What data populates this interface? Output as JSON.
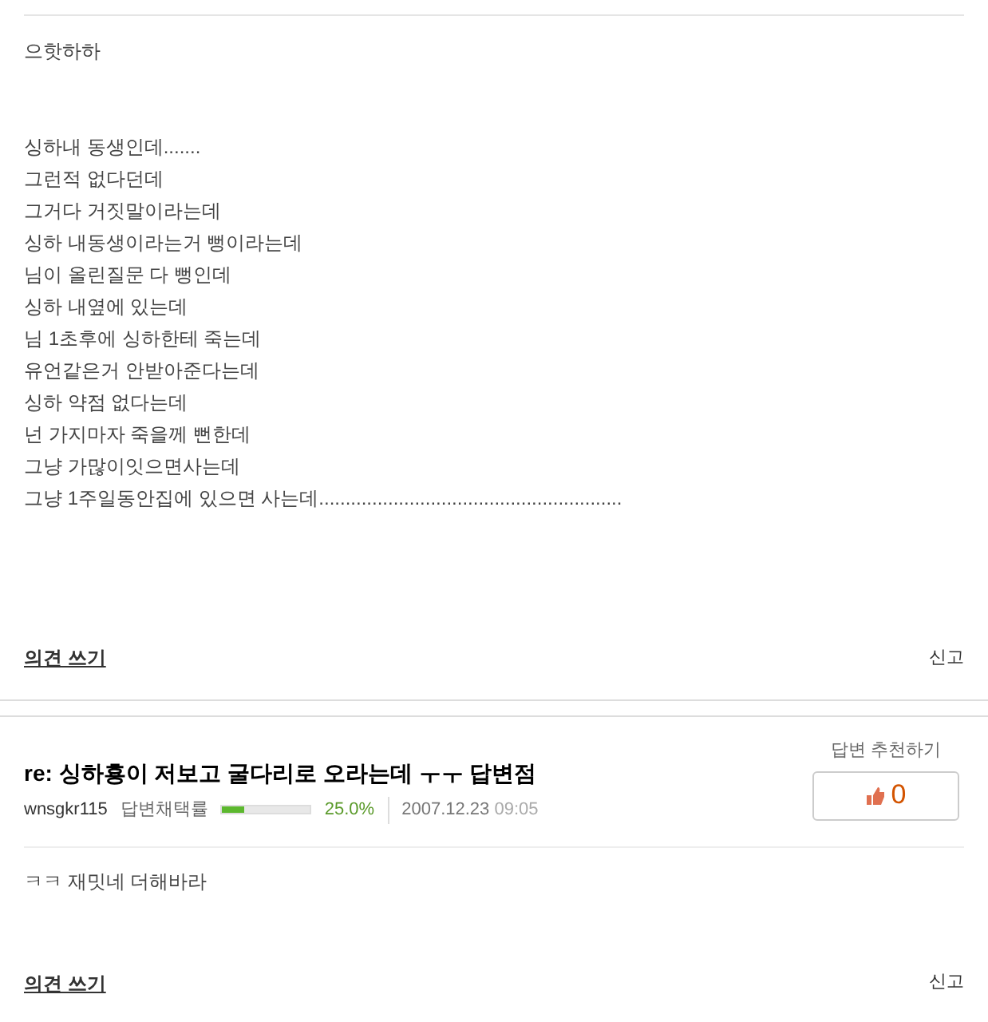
{
  "post": {
    "intro": "으핫하하",
    "lines": [
      "싱하내 동생인데.......",
      "그런적 없다던데",
      "그거다 거짓말이라는데",
      "싱하 내동생이라는거 뻥이라는데",
      "님이 올린질문 다 뻥인데",
      "싱하 내옆에 있는데",
      "님 1초후에 싱하한테 죽는데",
      "유언같은거 안받아준다는데",
      "싱하 약점 없다는데",
      "넌 가지마자 죽을께 뻔한데",
      "그냥 가많이잇으면사는데",
      "그냥 1주일동안집에 있으면 사는데........................................................."
    ],
    "comment_link": "의견 쓰기",
    "report_link": "신고"
  },
  "answer": {
    "title": "re: 싱하횽이 저보고 굴다리로 오라는데 ㅜㅜ 답변점",
    "user": "wnsgkr115",
    "rate_label": "답변채택률",
    "level": 0.25,
    "rate": "25.0%",
    "date": "2007.12.23",
    "time": "09:05",
    "recommend_label": "답변 추천하기",
    "recommend_count": "0",
    "body": "ㅋㅋ 재밋네 더해바라",
    "comment_link": "의견 쓰기",
    "report_link": "신고"
  }
}
